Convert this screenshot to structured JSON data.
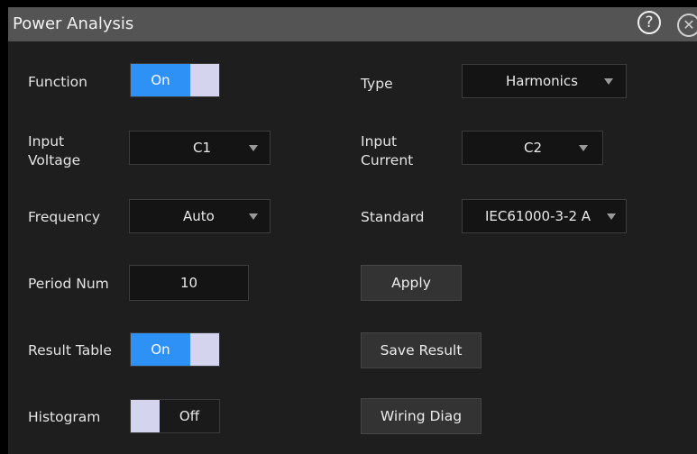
{
  "window": {
    "title": "Power Analysis",
    "help_icon": "?",
    "close_icon": "✕"
  },
  "function": {
    "label": "Function",
    "state": "On"
  },
  "input_voltage": {
    "label_line1": "Input",
    "label_line2": "Voltage",
    "value": "C1"
  },
  "frequency": {
    "label": "Frequency",
    "value": "Auto"
  },
  "period_num": {
    "label": "Period Num",
    "value": "10"
  },
  "result_table": {
    "label": "Result Table",
    "state": "On"
  },
  "histogram": {
    "label": "Histogram",
    "state": "Off"
  },
  "type": {
    "label": "Type",
    "value": "Harmonics"
  },
  "input_current": {
    "label_line1": "Input",
    "label_line2": "Current",
    "value": "C2"
  },
  "standard": {
    "label": "Standard",
    "value": "IEC61000-3-2 A"
  },
  "buttons": {
    "apply": "Apply",
    "save_result": "Save Result",
    "wiring_diag": "Wiring Diag"
  },
  "colors": {
    "accent": "#2e91f5",
    "knob": "#d4d4ef",
    "panel": "#1e1e1e",
    "titlebar": "#545454"
  }
}
